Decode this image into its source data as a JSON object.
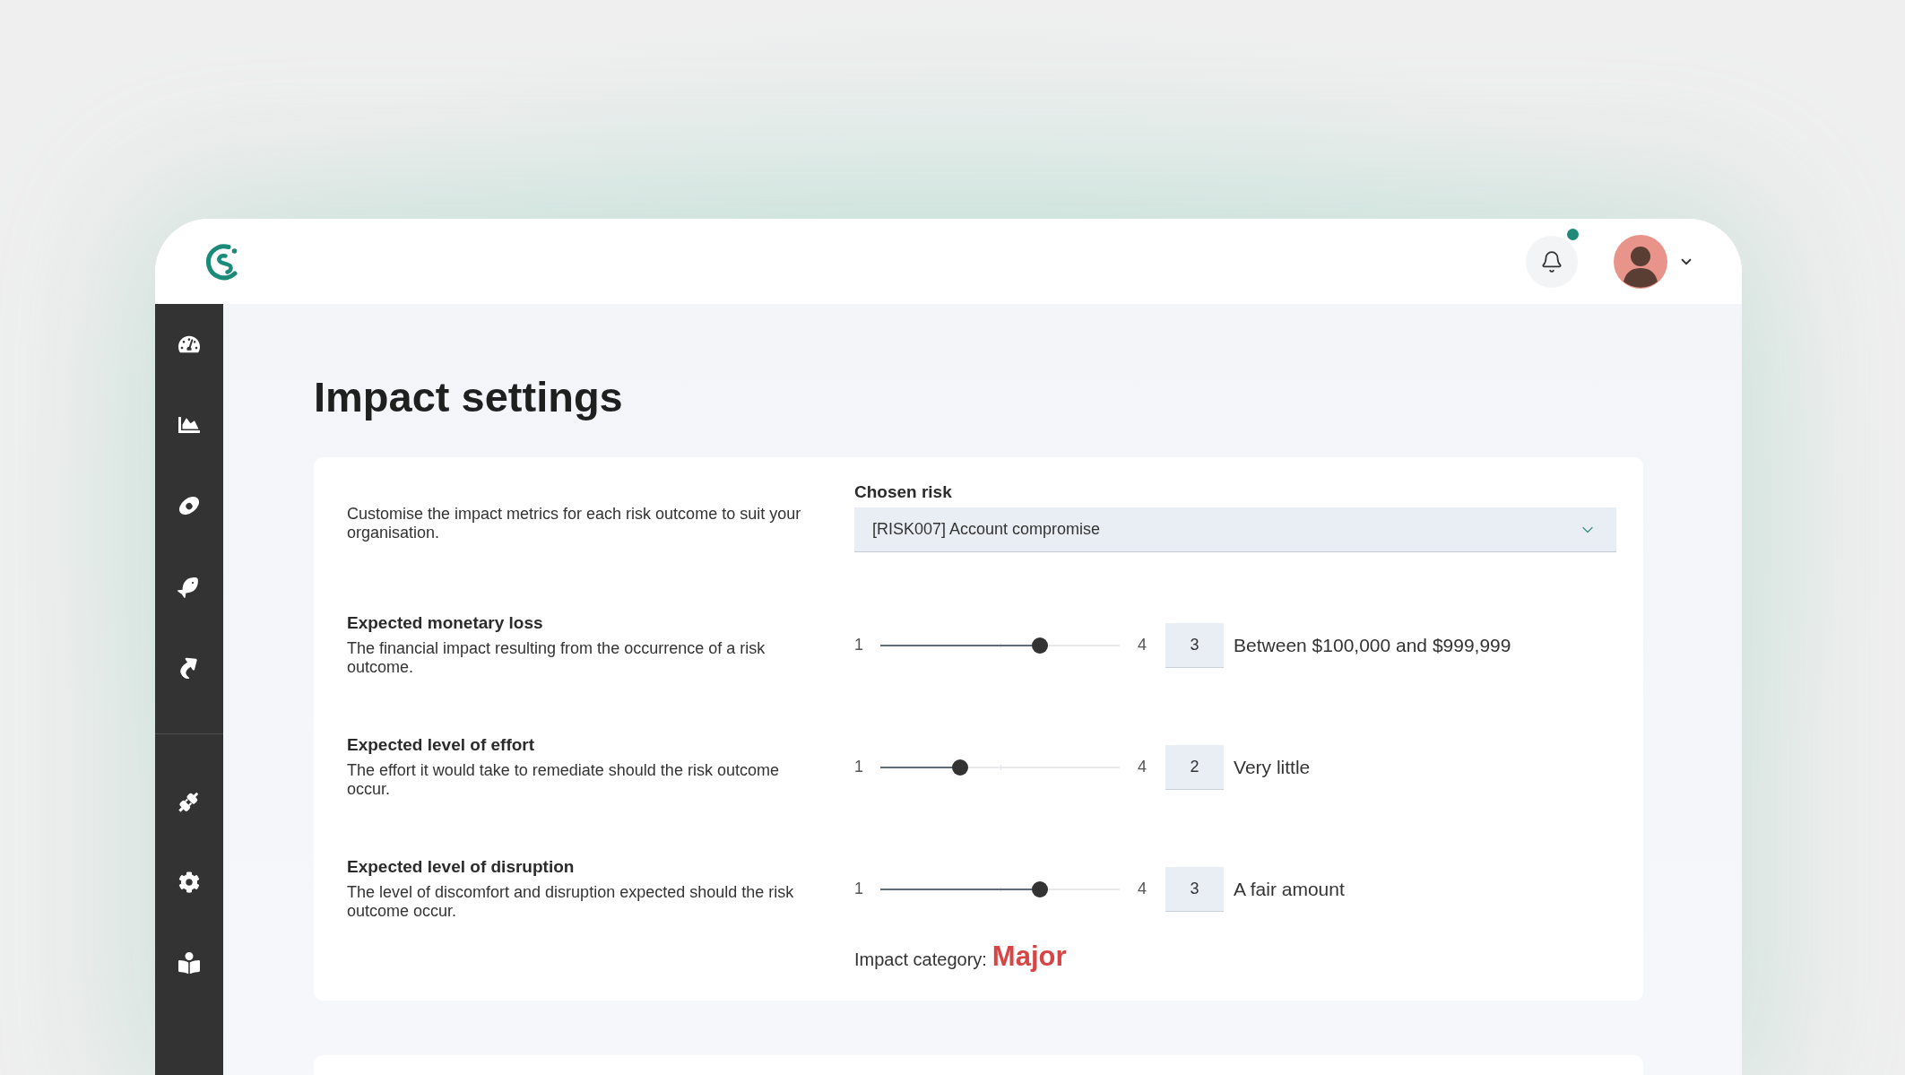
{
  "header": {
    "notification_unread": true
  },
  "page": {
    "title": "Impact settings"
  },
  "card": {
    "intro": "Customise the impact metrics for each risk outcome to suit your organisation.",
    "chosen_risk": {
      "label": "Chosen risk",
      "value": "[RISK007] Account compromise"
    },
    "metrics": [
      {
        "title": "Expected monetary loss",
        "description": "The financial impact resulting from the occurrence of a risk outcome.",
        "min": "1",
        "max": "4",
        "level": 0.667,
        "value": "3",
        "reading": "Between $100,000 and $999,999"
      },
      {
        "title": "Expected level of effort",
        "description": "The effort it would take to remediate should the risk outcome occur.",
        "min": "1",
        "max": "4",
        "level": 0.333,
        "value": "2",
        "reading": "Very little"
      },
      {
        "title": "Expected level of disruption",
        "description": "The level of discomfort and disruption expected should the risk outcome occur.",
        "min": "1",
        "max": "4",
        "level": 0.667,
        "value": "3",
        "reading": "A fair amount"
      }
    ],
    "impact_category": {
      "label": "Impact category:",
      "value": "Major"
    }
  }
}
